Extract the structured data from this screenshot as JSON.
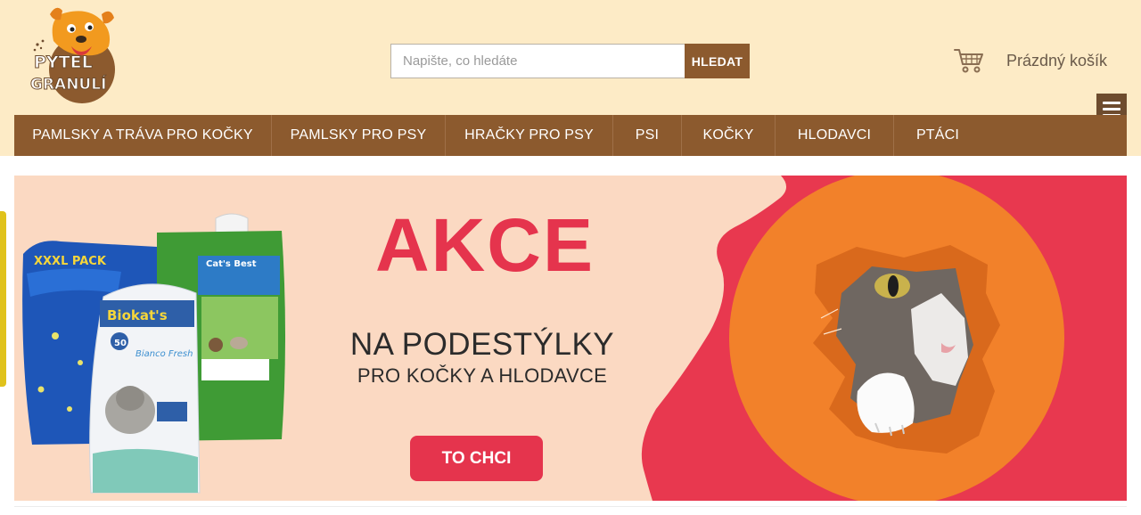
{
  "brand": {
    "logo_text_top": "PYTEL",
    "logo_text_bottom": "GRANULÍ",
    "accent_color": "#8c5a2e",
    "header_bg": "#fdebc6"
  },
  "search": {
    "placeholder": "Napište, co hledáte",
    "value": "",
    "button_label": "HLEDAT",
    "icon": "none"
  },
  "cart": {
    "icon": "cart-icon",
    "label": "Prázdný košík"
  },
  "menu": {
    "icon": "hamburger-icon"
  },
  "nav": {
    "items": [
      {
        "label": "PAMLSKY A TRÁVA PRO KOČKY"
      },
      {
        "label": "PAMLSKY PRO PSY"
      },
      {
        "label": "HRAČKY PRO PSY"
      },
      {
        "label": "PSI"
      },
      {
        "label": "KOČKY"
      },
      {
        "label": "HLODAVCI"
      },
      {
        "label": "PTÁCI"
      }
    ]
  },
  "banner": {
    "headline": "AKCE",
    "subtitle": "NA PODESTÝLKY",
    "subtitle2": "PRO KOČKY A HLODAVCE",
    "cta_label": "TO CHCI",
    "accent_color": "#e5344d",
    "products": [
      {
        "brand": "XXXL PACK"
      },
      {
        "brand": "Cat's Best"
      },
      {
        "brand": "Biokat's",
        "name": "Bianco Fresh",
        "size": "50"
      }
    ]
  }
}
